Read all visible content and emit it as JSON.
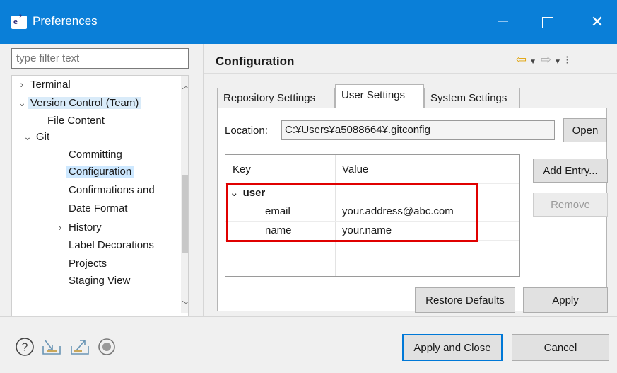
{
  "window": {
    "app_icon_text": "e",
    "title": "Preferences",
    "close_glyph": "✕"
  },
  "filter": {
    "placeholder": "type filter text"
  },
  "tree": {
    "items": [
      {
        "label": "Terminal",
        "twisty": "›"
      },
      {
        "label": "Version Control (Team)",
        "twisty": "⌄"
      },
      {
        "label": "File Content",
        "twisty": ""
      },
      {
        "label": "Git",
        "twisty": "⌄"
      },
      {
        "label": "Committing",
        "twisty": ""
      },
      {
        "label": "Configuration",
        "twisty": ""
      },
      {
        "label": "Confirmations and",
        "twisty": ""
      },
      {
        "label": "Date Format",
        "twisty": ""
      },
      {
        "label": "History",
        "twisty": "›"
      },
      {
        "label": "Label Decorations",
        "twisty": ""
      },
      {
        "label": "Projects",
        "twisty": ""
      },
      {
        "label": "Staging View",
        "twisty": ""
      }
    ],
    "selected": "Configuration"
  },
  "page": {
    "title": "Configuration"
  },
  "tabs": [
    {
      "label": "Repository Settings"
    },
    {
      "label": "User Settings"
    },
    {
      "label": "System Settings"
    }
  ],
  "active_tab": "User Settings",
  "location": {
    "label": "Location:",
    "value": "C:¥Users¥a5088664¥.gitconfig",
    "open_label": "Open"
  },
  "table": {
    "headers": [
      "Key",
      "Value"
    ],
    "rows": [
      {
        "key": "user",
        "value": "",
        "twisty": "⌄"
      },
      {
        "key": "email",
        "value": "your.address@abc.com"
      },
      {
        "key": "name",
        "value": "your.name"
      }
    ]
  },
  "buttons": {
    "add_entry": "Add Entry...",
    "remove": "Remove",
    "restore_defaults": "Restore Defaults",
    "apply": "Apply",
    "apply_and_close": "Apply and Close",
    "cancel": "Cancel"
  },
  "colors": {
    "titlebar": "#0a7fd8",
    "selection": "#cde8ff",
    "highlight_box": "#e00000"
  },
  "bottom_icons": [
    "help-icon",
    "import-icon",
    "export-icon",
    "record-icon"
  ]
}
